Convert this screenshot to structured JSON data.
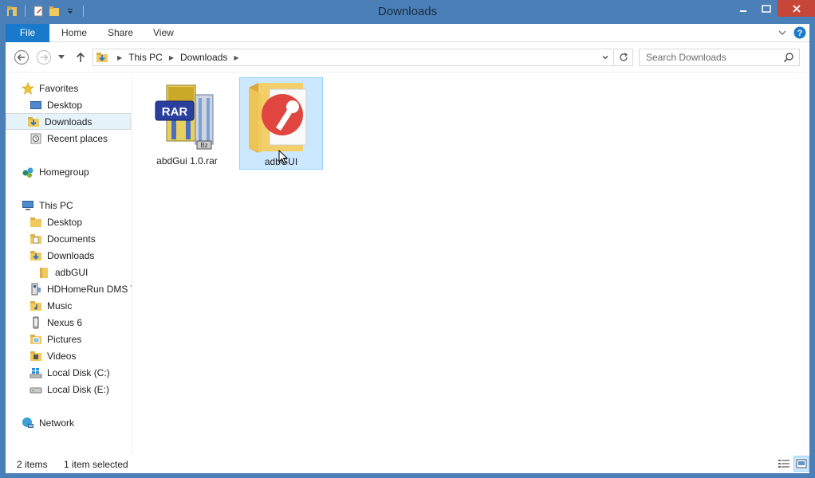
{
  "window": {
    "title": "Downloads"
  },
  "ribbon": {
    "file": "File",
    "home": "Home",
    "share": "Share",
    "view": "View"
  },
  "address": {
    "crumbs": [
      "This PC",
      "Downloads"
    ]
  },
  "search": {
    "placeholder": "Search Downloads"
  },
  "nav": {
    "favorites": "Favorites",
    "desktop": "Desktop",
    "downloads": "Downloads",
    "recent": "Recent places",
    "homegroup": "Homegroup",
    "thispc": "This PC",
    "pc_desktop": "Desktop",
    "pc_documents": "Documents",
    "pc_downloads": "Downloads",
    "pc_adbgui": "adbGUI",
    "pc_hdhomerun": "HDHomeRun DMS T",
    "pc_music": "Music",
    "pc_nexus": "Nexus 6",
    "pc_pictures": "Pictures",
    "pc_videos": "Videos",
    "pc_localc": "Local Disk (C:)",
    "pc_locale": "Local Disk (E:)",
    "network": "Network"
  },
  "files": [
    {
      "name": "abdGui 1.0.rar"
    },
    {
      "name": "adbGUI"
    }
  ],
  "status": {
    "count": "2 items",
    "selected": "1 item selected"
  },
  "colors": {
    "titlebar": "#4a7fb8",
    "file_tab": "#1979ca",
    "close": "#c7463a",
    "selection": "#cce8ff"
  }
}
